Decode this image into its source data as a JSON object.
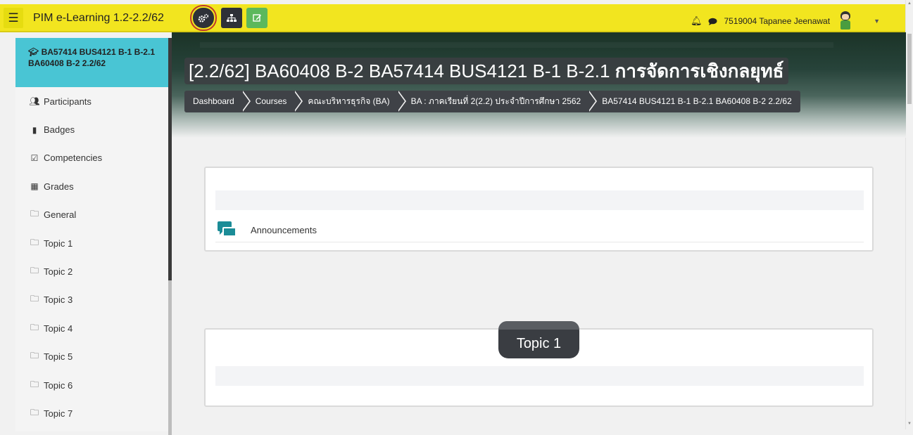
{
  "navbar": {
    "site_name": "PIM e-Learning 1.2-2.2/62",
    "hamburger_icon": "bars-icon",
    "buttons": [
      {
        "name": "settings-cogs-button",
        "icon": "cogs-icon",
        "color": "#2e3138"
      },
      {
        "name": "sitemap-button",
        "icon": "sitemap-icon",
        "color": "#2e3138"
      },
      {
        "name": "edit-mode-button",
        "icon": "edit-icon",
        "color": "#5cb85c"
      }
    ],
    "user_name": "7519004 Tapanee Jeenawat",
    "accent_color": "#f2e51f"
  },
  "sidebar": {
    "course_label": "BA57414 BUS4121 B-1 B-2.1 BA60408 B-2 2.2/62",
    "course_color": "#49c5d4",
    "items": [
      {
        "label": "Participants",
        "icon": "users-icon"
      },
      {
        "label": "Badges",
        "icon": "shield-icon"
      },
      {
        "label": "Competencies",
        "icon": "check-square-icon"
      },
      {
        "label": "Grades",
        "icon": "table-icon"
      },
      {
        "label": "General",
        "icon": "folder-icon"
      },
      {
        "label": "Topic 1",
        "icon": "folder-icon"
      },
      {
        "label": "Topic 2",
        "icon": "folder-icon"
      },
      {
        "label": "Topic 3",
        "icon": "folder-icon"
      },
      {
        "label": "Topic 4",
        "icon": "folder-icon"
      },
      {
        "label": "Topic 5",
        "icon": "folder-icon"
      },
      {
        "label": "Topic 6",
        "icon": "folder-icon"
      },
      {
        "label": "Topic 7",
        "icon": "folder-icon"
      }
    ]
  },
  "header": {
    "title_plain": "[2.2/62] BA60408 B-2 BA57414 BUS4121 B-1 B-2.1 ",
    "title_bold": "การจัดการเชิงกลยุทธ์",
    "breadcrumbs": [
      "Dashboard",
      "Courses",
      "คณะบริหารธุรกิจ (BA)",
      "BA : ภาคเรียนที่ 2(2.2) ประจำปีการศึกษา 2562",
      "BA57414 BUS4121 B-1 B-2.1 BA60408 B-2 2.2/62"
    ]
  },
  "sections": {
    "general": {
      "activities": [
        {
          "label": "Announcements",
          "icon": "comments-icon",
          "icon_color": "#1b8c97"
        }
      ]
    },
    "topic1": {
      "title": "Topic 1"
    }
  }
}
